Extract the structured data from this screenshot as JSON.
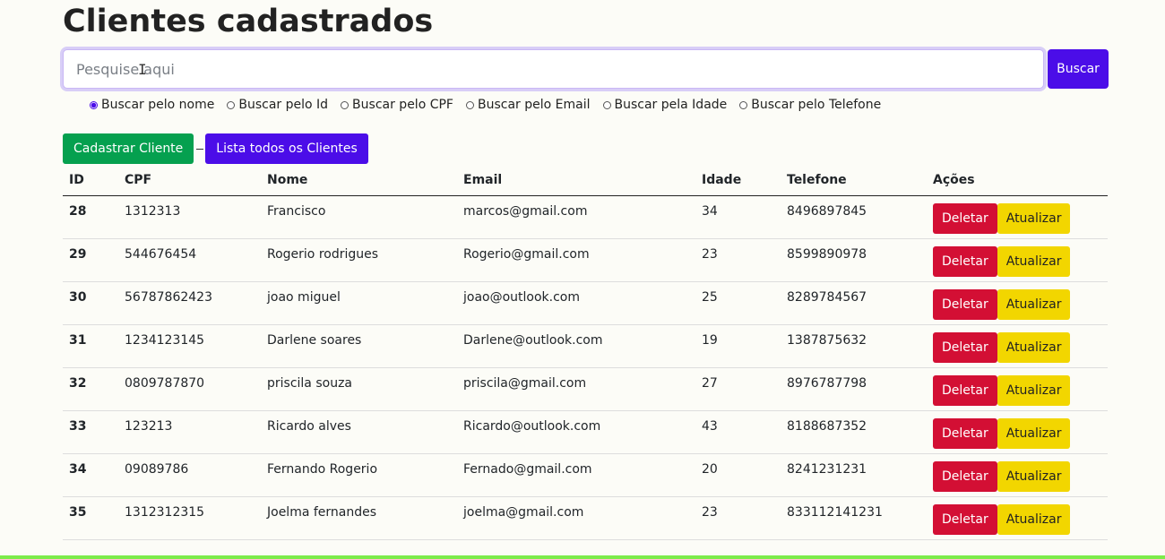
{
  "page_title": "Clientes cadastrados",
  "search": {
    "placeholder": "Pesquise aqui",
    "value": "",
    "button_label": "Buscar"
  },
  "radio_options": [
    {
      "label": "Buscar pelo nome",
      "checked": true
    },
    {
      "label": "Buscar pelo Id",
      "checked": false
    },
    {
      "label": "Buscar pelo CPF",
      "checked": false
    },
    {
      "label": "Buscar pelo Email",
      "checked": false
    },
    {
      "label": "Buscar pela Idade",
      "checked": false
    },
    {
      "label": "Buscar pelo Telefone",
      "checked": false
    }
  ],
  "buttons": {
    "register": "Cadastrar Cliente",
    "list_all": "Lista todos os Clientes"
  },
  "table": {
    "headers": [
      "ID",
      "CPF",
      "Nome",
      "Email",
      "Idade",
      "Telefone",
      "Ações"
    ],
    "delete_label": "Deletar",
    "update_label": "Atualizar",
    "rows": [
      [
        "28",
        "1312313",
        "Francisco",
        "marcos@gmail.com",
        "34",
        "8496897845"
      ],
      [
        "29",
        "544676454",
        "Rogerio rodrigues",
        "Rogerio@gmail.com",
        "23",
        "8599890978"
      ],
      [
        "30",
        "56787862423",
        "joao miguel",
        "joao@outlook.com",
        "25",
        "8289784567"
      ],
      [
        "31",
        "1234123145",
        "Darlene soares",
        "Darlene@outlook.com",
        "19",
        "1387875632"
      ],
      [
        "32",
        "0809787870",
        "priscila souza",
        "priscila@gmail.com",
        "27",
        "8976787798"
      ],
      [
        "33",
        "123213",
        "Ricardo alves",
        "Ricardo@outlook.com",
        "43",
        "8188687352"
      ],
      [
        "34",
        "09089786",
        "Fernando Rogerio",
        "Fernado@gmail.com",
        "20",
        "8241231231"
      ],
      [
        "35",
        "1312312315",
        "Joelma fernandes",
        "joelma@gmail.com",
        "23",
        "833112141231"
      ]
    ]
  },
  "colors": {
    "primary": "#4b0de8",
    "success": "#05a04f",
    "danger": "#d30f34",
    "warning": "#f2d600",
    "bottom_bar": "#7cec4a"
  }
}
